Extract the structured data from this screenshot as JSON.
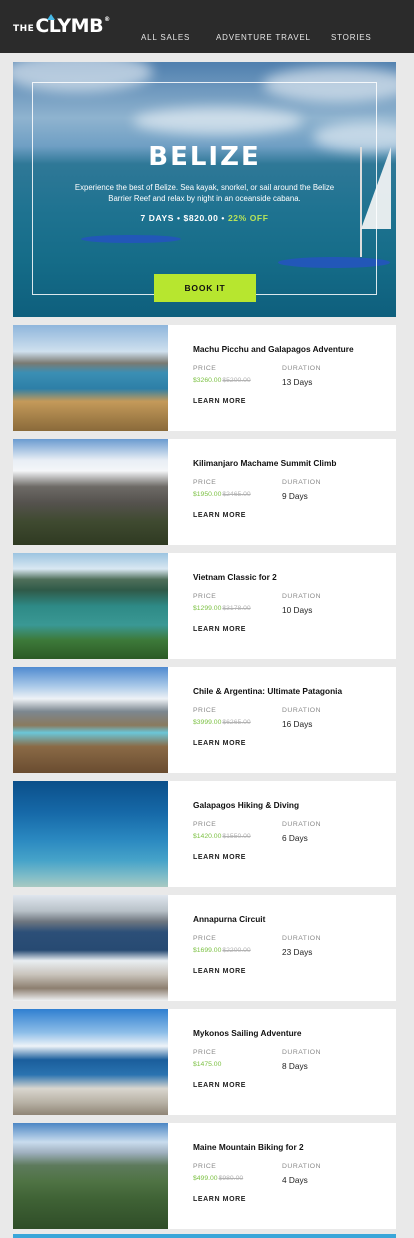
{
  "brand": {
    "the": "THE",
    "clymb": "CLYMB",
    "reg": "®"
  },
  "nav": [
    {
      "label": "ALL SALES"
    },
    {
      "label": "ADVENTURE TRAVEL"
    },
    {
      "label": "STORIES"
    }
  ],
  "hero": {
    "title": "BELIZE",
    "description": "Experience the best of Belize. Sea kayak, snorkel, or sail around the Belize Barrier Reef and relax by night in an oceanside cabana.",
    "days": "7 DAYS",
    "price": "$820.00",
    "discount": "22% OFF",
    "cta": "BOOK IT"
  },
  "labels": {
    "price": "PRICE",
    "duration": "DURATION",
    "learn_more": "LEARN MORE"
  },
  "trips": [
    {
      "title": "Machu Picchu and Galapagos Adventure",
      "price": "$3260.00",
      "old_price": "$5200.00",
      "duration": "13 Days"
    },
    {
      "title": "Kilimanjaro Machame Summit Climb",
      "price": "$1950.00",
      "old_price": "$2465.00",
      "duration": "9 Days"
    },
    {
      "title": "Vietnam Classic for 2",
      "price": "$1299.00",
      "old_price": "$3178.00",
      "duration": "10 Days"
    },
    {
      "title": "Chile & Argentina: Ultimate Patagonia",
      "price": "$3999.00",
      "old_price": "$6265.00",
      "duration": "16 Days"
    },
    {
      "title": "Galapagos Hiking & Diving",
      "price": "$1420.00",
      "old_price": "$1550.00",
      "duration": "6 Days"
    },
    {
      "title": "Annapurna Circuit",
      "price": "$1699.00",
      "old_price": "$2200.00",
      "duration": "23 Days"
    },
    {
      "title": "Mykonos Sailing Adventure",
      "price": "$1475.00",
      "old_price": "",
      "duration": "8 Days"
    },
    {
      "title": "Maine Mountain Biking for 2",
      "price": "$499.00",
      "old_price": "$980.00",
      "duration": "4 Days"
    }
  ],
  "colors": {
    "accent_green": "#b7e62f",
    "price_green": "#7cc143",
    "topbar": "#2b2b2b",
    "logo_peak": "#46b9e6"
  }
}
